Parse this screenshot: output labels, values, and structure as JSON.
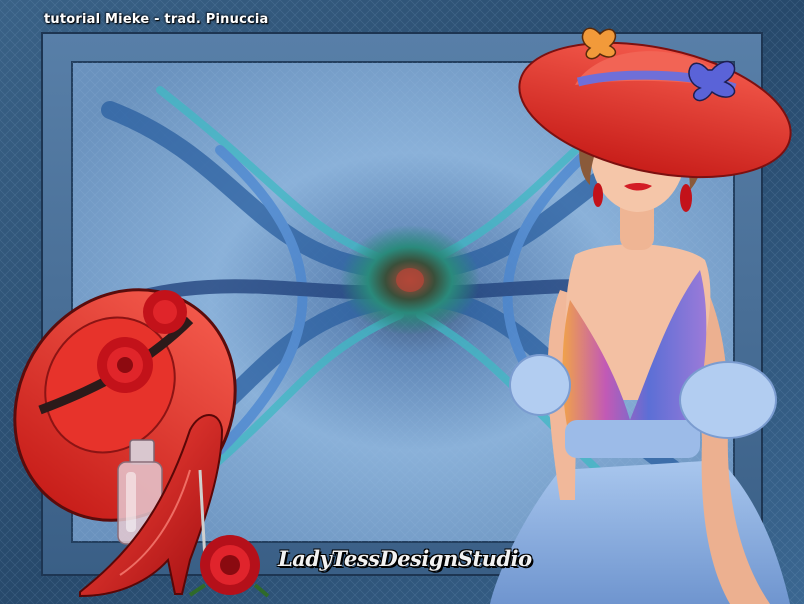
{
  "caption": "tutorial Mieke - trad. Pinuccia",
  "signature": "LadyTessDesignStudio",
  "palette": {
    "background": "#2c4f72",
    "frame": "#4f7aa6",
    "inner_panel": "#6f9bc9",
    "hat_red": "#e8342c",
    "dress_blue": "#8fb3e3",
    "rose_red": "#c3121a"
  }
}
